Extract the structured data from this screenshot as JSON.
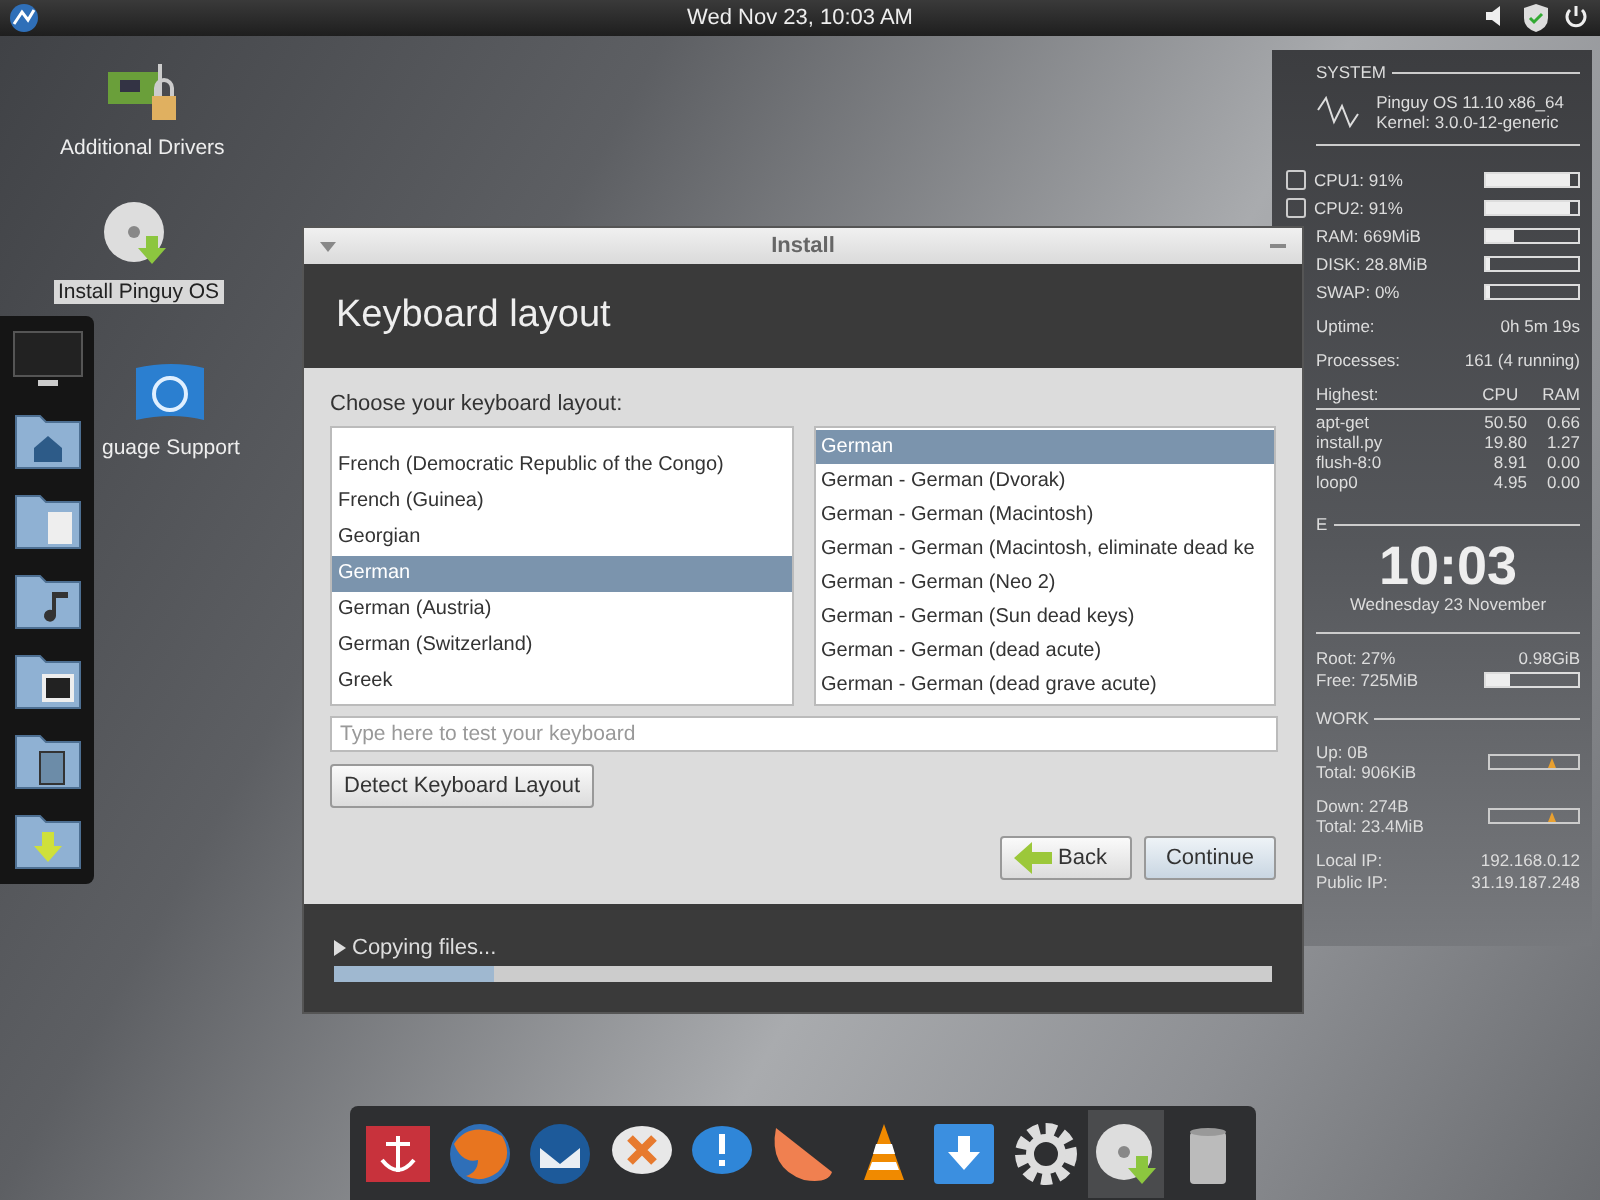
{
  "top_bar": {
    "clock": "Wed Nov 23, 10:03 AM"
  },
  "desktop_icons": [
    {
      "kind": "drivers",
      "label": "Additional Drivers",
      "selected": false
    },
    {
      "kind": "disc",
      "label": "Install Pinguy OS",
      "selected": true
    },
    {
      "kind": "flag",
      "label": "guage Support",
      "selected": false
    }
  ],
  "install_window": {
    "title": "Install",
    "heading": "Keyboard layout",
    "prompt": "Choose your keyboard layout:",
    "layouts": [
      {
        "label": "French (Democratic Republic of the Congo)",
        "selected": false
      },
      {
        "label": "French (Guinea)",
        "selected": false
      },
      {
        "label": "Georgian",
        "selected": false
      },
      {
        "label": "German",
        "selected": true
      },
      {
        "label": "German (Austria)",
        "selected": false
      },
      {
        "label": "German (Switzerland)",
        "selected": false
      },
      {
        "label": "Greek",
        "selected": false
      }
    ],
    "variants": [
      {
        "label": "German",
        "selected": true
      },
      {
        "label": "German - German (Dvorak)",
        "selected": false
      },
      {
        "label": "German - German (Macintosh)",
        "selected": false
      },
      {
        "label": "German - German (Macintosh, eliminate dead ke",
        "selected": false
      },
      {
        "label": "German - German (Neo 2)",
        "selected": false
      },
      {
        "label": "German - German (Sun dead keys)",
        "selected": false
      },
      {
        "label": "German - German (dead acute)",
        "selected": false
      },
      {
        "label": "German - German (dead grave acute)",
        "selected": false
      }
    ],
    "test_field": {
      "placeholder": "Type here to test your keyboard"
    },
    "detect_button": "Detect Keyboard Layout",
    "back_button": "Back",
    "continue_button": "Continue",
    "progress": {
      "label": "Copying files...",
      "expanded": false,
      "level": 0.17
    }
  },
  "system_monitor": {
    "section": "SYSTEM",
    "os": "Pinguy OS 11.10 x86_64",
    "kernel": "Kernel: 3.0.0-12-generic",
    "meters": [
      {
        "kind": "cpu",
        "label": "CPU1: 91%",
        "level": 0.91
      },
      {
        "kind": "cpu",
        "label": "CPU2: 91%",
        "level": 0.91
      },
      {
        "kind": "plain",
        "label": "RAM: 669MiB",
        "level": 0.3
      },
      {
        "kind": "plain",
        "label": "DISK: 28.8MiB",
        "level": 0.03
      },
      {
        "kind": "plain",
        "label": "SWAP: 0%",
        "level": 0
      }
    ],
    "stats": [
      {
        "label": "Uptime:",
        "value": "0h 5m 19s"
      },
      {
        "label": "Processes:",
        "value": "161 (4 running)"
      }
    ],
    "top_header": [
      "Highest:",
      "CPU",
      "RAM"
    ],
    "top_rows": [
      [
        "apt-get",
        "50.50",
        "0.66"
      ],
      [
        "install.py",
        "19.80",
        "1.27"
      ],
      [
        "flush-8:0",
        "8.91",
        "0.00"
      ],
      [
        "loop0",
        "4.95",
        "0.00"
      ]
    ],
    "time_section": "E",
    "time": "10:03",
    "date": "Wednesday 23 November",
    "disk": {
      "root": "Root: 27%",
      "size": "0.98GiB",
      "free": "Free: 725MiB",
      "level": 0.27
    },
    "network_section": "WORK",
    "network": [
      {
        "rate": "Up: 0B",
        "total": "Total: 906KiB"
      },
      {
        "rate": "Down: 274B",
        "total": "Total: 23.4MiB"
      }
    ],
    "ips": [
      {
        "label": "Local IP:",
        "value": "192.168.0.12"
      },
      {
        "label": "Public IP:",
        "value": "31.19.187.248"
      }
    ]
  },
  "dock": [
    {
      "kind": "anchor",
      "selected": false
    },
    {
      "kind": "browser",
      "selected": false
    },
    {
      "kind": "mail",
      "selected": false
    },
    {
      "kind": "chat-x",
      "selected": false
    },
    {
      "kind": "chat-alert",
      "selected": false
    },
    {
      "kind": "slice",
      "selected": false
    },
    {
      "kind": "cone",
      "selected": false
    },
    {
      "kind": "download",
      "selected": false
    },
    {
      "kind": "gear",
      "selected": false
    },
    {
      "kind": "disc",
      "selected": true
    },
    {
      "kind": "trash",
      "selected": false
    }
  ]
}
